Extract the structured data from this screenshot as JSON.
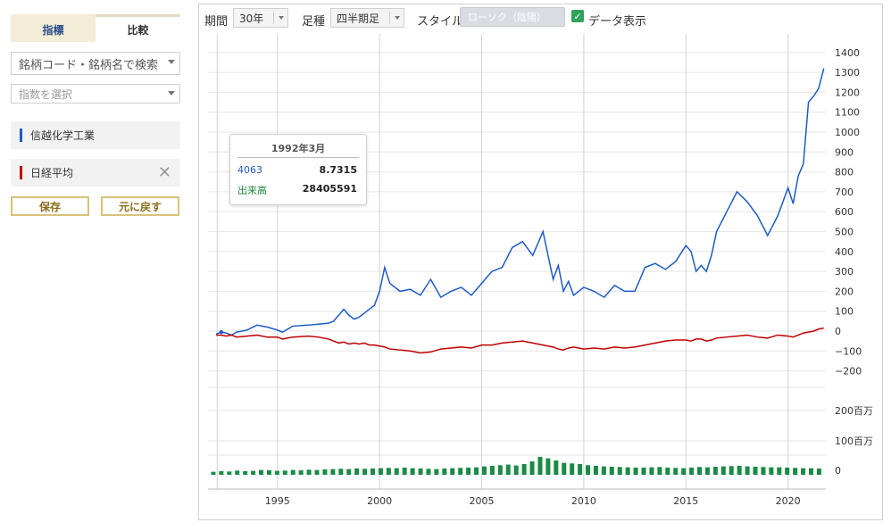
{
  "sidebar": {
    "tabs": [
      {
        "label": "指標",
        "active": false
      },
      {
        "label": "比較",
        "active": true
      }
    ],
    "search": {
      "placeholder": "銘柄コード・銘柄名で検索"
    },
    "index_select": {
      "placeholder": "指数を選択"
    },
    "series": [
      {
        "label": "信越化学工業",
        "color": "#1e5bc6",
        "removable": false
      },
      {
        "label": "日経平均",
        "color": "#c00000",
        "removable": true
      }
    ],
    "save_label": "保存",
    "reset_label": "元に戻す"
  },
  "toolbar": {
    "period_label": "期間",
    "period_value": "30年",
    "candle_label": "足種",
    "candle_value": "四半期足",
    "style_label": "スタイル",
    "style_value": "ローソク（陰陽）",
    "data_display_label": "データ表示",
    "data_display_checked": true
  },
  "tooltip": {
    "title": "1992年3月",
    "rows": [
      {
        "key": "4063",
        "value": "8.7315",
        "color": "#1e5bc6"
      },
      {
        "key": "出来高",
        "value": "28405591",
        "color": "#1e8a3c"
      }
    ]
  },
  "chart_data": {
    "type": "line",
    "x_tick_labels": [
      "1995",
      "2000",
      "2005",
      "2010",
      "2015",
      "2020"
    ],
    "y_tick_labels": [
      "1400",
      "1300",
      "1200",
      "1100",
      "1000",
      "900",
      "800",
      "700",
      "600",
      "500",
      "400",
      "300",
      "200",
      "100",
      "0",
      "−100",
      "−200"
    ],
    "ylim": [
      -200,
      1400
    ],
    "volume_tick_labels": [
      "200百万",
      "100百万",
      "0"
    ],
    "volume_ylim": [
      0,
      200
    ],
    "grid": true,
    "x": [
      1992.0,
      1992.25,
      1992.5,
      1992.75,
      1993.0,
      1993.5,
      1994.0,
      1994.5,
      1995.0,
      1995.25,
      1995.75,
      1996.5,
      1997.0,
      1997.5,
      1997.75,
      1998.0,
      1998.25,
      1998.5,
      1998.75,
      1999.0,
      1999.25,
      1999.5,
      1999.75,
      2000.0,
      2000.25,
      2000.5,
      2001.0,
      2001.5,
      2002.0,
      2002.5,
      2003.0,
      2003.5,
      2004.0,
      2004.5,
      2005.0,
      2005.5,
      2006.0,
      2006.5,
      2007.0,
      2007.5,
      2008.0,
      2008.5,
      2008.75,
      2009.0,
      2009.25,
      2009.5,
      2010.0,
      2010.5,
      2011.0,
      2011.5,
      2012.0,
      2012.5,
      2013.0,
      2013.5,
      2014.0,
      2014.5,
      2015.0,
      2015.25,
      2015.5,
      2015.75,
      2016.0,
      2016.25,
      2016.5,
      2017.0,
      2017.5,
      2018.0,
      2018.5,
      2019.0,
      2019.5,
      2020.0,
      2020.25,
      2020.5,
      2020.75,
      2021.0,
      2021.25,
      2021.5,
      2021.75
    ],
    "series": [
      {
        "name": "信越化学工業",
        "values": [
          -15,
          -5,
          -10,
          -20,
          -5,
          5,
          30,
          20,
          5,
          -5,
          25,
          30,
          35,
          40,
          50,
          80,
          110,
          80,
          60,
          70,
          90,
          110,
          130,
          200,
          320,
          240,
          200,
          210,
          180,
          260,
          170,
          200,
          220,
          180,
          240,
          300,
          320,
          420,
          450,
          380,
          500,
          260,
          330,
          200,
          250,
          180,
          220,
          200,
          170,
          230,
          200,
          200,
          320,
          340,
          310,
          350,
          430,
          400,
          300,
          330,
          300,
          380,
          500,
          600,
          700,
          650,
          580,
          480,
          580,
          720,
          640,
          780,
          840,
          1150,
          1180,
          1220,
          1320
        ]
      },
      {
        "name": "日経平均",
        "values": [
          -20,
          -20,
          -25,
          -20,
          -30,
          -25,
          -20,
          -30,
          -30,
          -40,
          -30,
          -25,
          -30,
          -40,
          -50,
          -60,
          -55,
          -65,
          -60,
          -65,
          -60,
          -70,
          -70,
          -75,
          -80,
          -90,
          -95,
          -100,
          -110,
          -105,
          -90,
          -85,
          -80,
          -85,
          -70,
          -70,
          -60,
          -55,
          -50,
          -60,
          -70,
          -80,
          -90,
          -95,
          -85,
          -80,
          -90,
          -85,
          -90,
          -80,
          -85,
          -80,
          -70,
          -60,
          -50,
          -45,
          -45,
          -50,
          -40,
          -40,
          -50,
          -45,
          -35,
          -30,
          -25,
          -20,
          -30,
          -35,
          -20,
          -25,
          -30,
          -20,
          -10,
          -5,
          0,
          10,
          15
        ]
      }
    ],
    "volume": [
      10,
      12,
      11,
      14,
      12,
      13,
      16,
      15,
      13,
      14,
      16,
      15,
      17,
      16,
      18,
      19,
      20,
      19,
      21,
      20,
      21,
      22,
      23,
      22,
      24,
      22,
      21,
      20,
      19,
      21,
      22,
      23,
      24,
      25,
      28,
      30,
      32,
      34,
      31,
      36,
      45,
      60,
      55,
      48,
      40,
      38,
      36,
      32,
      30,
      28,
      27,
      26,
      25,
      24,
      24,
      25,
      26,
      24,
      23,
      22,
      24,
      26,
      25,
      27,
      28,
      29,
      30,
      28,
      27,
      26,
      25,
      25,
      24,
      23,
      22,
      22,
      21
    ]
  }
}
